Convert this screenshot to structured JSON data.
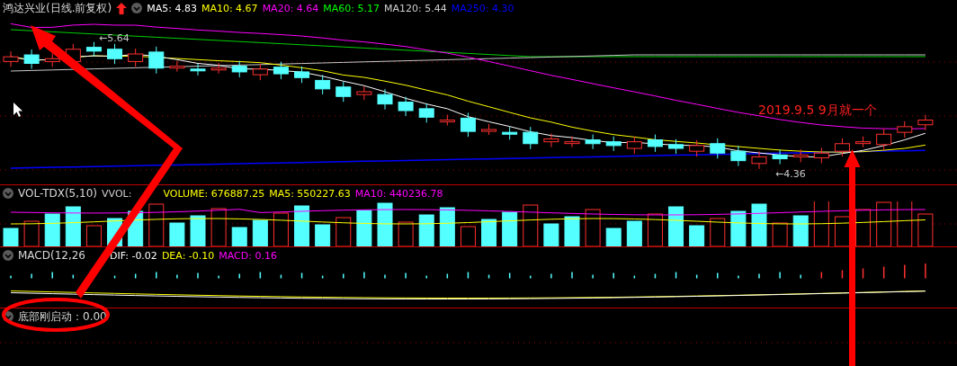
{
  "main_panel": {
    "title": "鸿达兴业(日线.前复权)",
    "indicators": [
      {
        "label": "MA5: 4.83",
        "color": "#ffffff"
      },
      {
        "label": "MA10: 4.67",
        "color": "#ffff00"
      },
      {
        "label": "MA20: 4.64",
        "color": "#ff00ff"
      },
      {
        "label": "MA60: 5.17",
        "color": "#00ff00"
      },
      {
        "label": "MA120: 5.44",
        "color": "#d0d0d0"
      },
      {
        "label": "MA250: 4.30",
        "color": "#0000ff"
      }
    ],
    "high_label": "←5.64",
    "low_label": "←4.36",
    "annotation": "2019.9.5  9月就一个"
  },
  "volume_panel": {
    "title": "VOL-TDX(5,10)",
    "indicators": [
      {
        "label": "VVOL:",
        "color": "#d0d0d0"
      },
      {
        "label": "VOLUME: 676887.25",
        "color": "#ffff00"
      },
      {
        "label": "MA5: 550227.63",
        "color": "#ffff00"
      },
      {
        "label": "MA10: 440236.78",
        "color": "#ff00ff"
      }
    ]
  },
  "macd_panel": {
    "title": "MACD(12,26",
    "indicators": [
      {
        "label": "DIF: -0.02",
        "color": "#ffffff"
      },
      {
        "label": "DEA: -0.10",
        "color": "#ffff00"
      },
      {
        "label": "MACD: 0.16",
        "color": "#ff00ff"
      }
    ]
  },
  "signal_panel": {
    "title": "底部刚启动",
    "value": "：0.00"
  }
}
